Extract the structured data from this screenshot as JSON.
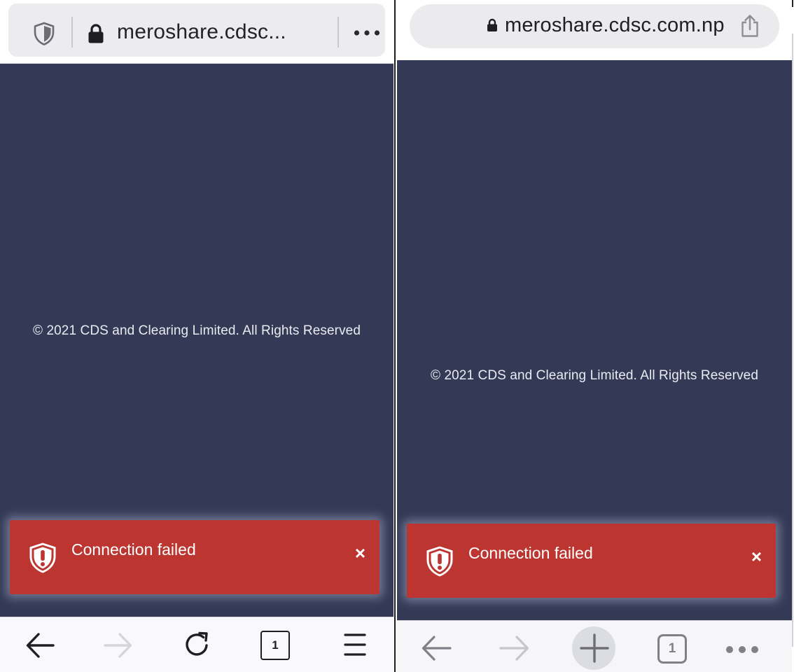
{
  "left_browser": {
    "url_text": "meroshare.cdsc...",
    "footer_copyright": "© 2021 CDS and Clearing Limited. All Rights Reserved",
    "toast_message": "Connection failed",
    "toast_close": "×",
    "tab_count": "1",
    "icons": [
      "shield-icon",
      "lock-icon",
      "more-horizontal-icon",
      "back-arrow-icon",
      "forward-arrow-icon",
      "reload-icon",
      "tabs-icon",
      "hamburger-menu-icon",
      "warning-shield-icon",
      "close-icon"
    ]
  },
  "right_browser": {
    "url_text": "meroshare.cdsc.com.np",
    "footer_copyright": "© 2021 CDS and Clearing Limited. All Rights Reserved",
    "toast_message": "Connection failed",
    "toast_close": "×",
    "tab_count": "1",
    "icons": [
      "lock-icon",
      "share-icon",
      "back-arrow-icon",
      "forward-arrow-icon",
      "new-tab-plus-icon",
      "tabs-icon",
      "more-horizontal-icon",
      "warning-shield-icon",
      "close-icon"
    ]
  },
  "colors": {
    "page_background": "#343a56",
    "toast_background": "#bd3530",
    "toolbar_background": "#f9f9fb",
    "url_bar_background": "#ececf0"
  }
}
